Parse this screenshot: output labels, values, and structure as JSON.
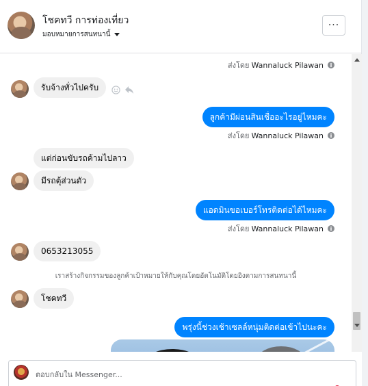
{
  "header": {
    "title": "โชคทวี การท่องเที่ยว",
    "subtitle": "มอบหมายการสนทนานี้",
    "more_label": "···"
  },
  "messages": [
    {
      "kind": "meta",
      "prefix": "ส่งโดย",
      "author": "Wannaluck Pilawan"
    },
    {
      "kind": "incoming",
      "text": "รับจ้างทั่วไปครับ"
    },
    {
      "kind": "outgoing",
      "text": "ลูกค้ามีผ่อนสินเชื่ออะไรอยู่ไหมคะ"
    },
    {
      "kind": "meta",
      "prefix": "ส่งโดย",
      "author": "Wannaluck Pilawan"
    },
    {
      "kind": "incoming",
      "text": "แต่ก่อนขับรถค้ามไปลาว"
    },
    {
      "kind": "incoming",
      "text": "มีรถตุ้ส่วนตัว"
    },
    {
      "kind": "outgoing",
      "text": "แอดมินขอเบอร์โทรติดต่อได้ไหมคะ"
    },
    {
      "kind": "meta",
      "prefix": "ส่งโดย",
      "author": "Wannaluck Pilawan"
    },
    {
      "kind": "incoming",
      "text": "0653213055"
    },
    {
      "kind": "system",
      "text": "เราสร้างกิจกรรมของลูกค้าเป้าหมายให้กับคุณโดยอัตโนมัติโดยอิงตามการสนทนานี้"
    },
    {
      "kind": "incoming",
      "text": "โชคทวี"
    },
    {
      "kind": "outgoing",
      "text": "พรุ่งนี้ช่วงเช้าเซลล์หนุ่มติดต่อเข้าไปนะคะ"
    }
  ],
  "composer": {
    "placeholder": "ตอบกลับใน Messenger..."
  },
  "icons": {
    "info": "info-icon",
    "emoji": "smiley-icon",
    "reply": "reply-icon",
    "more": "more-dots-icon",
    "caret": "caret-down-icon"
  },
  "colors": {
    "outgoing_bubble": "#0084ff",
    "incoming_bubble": "#f0f0f0",
    "meta_text": "#65676b"
  }
}
